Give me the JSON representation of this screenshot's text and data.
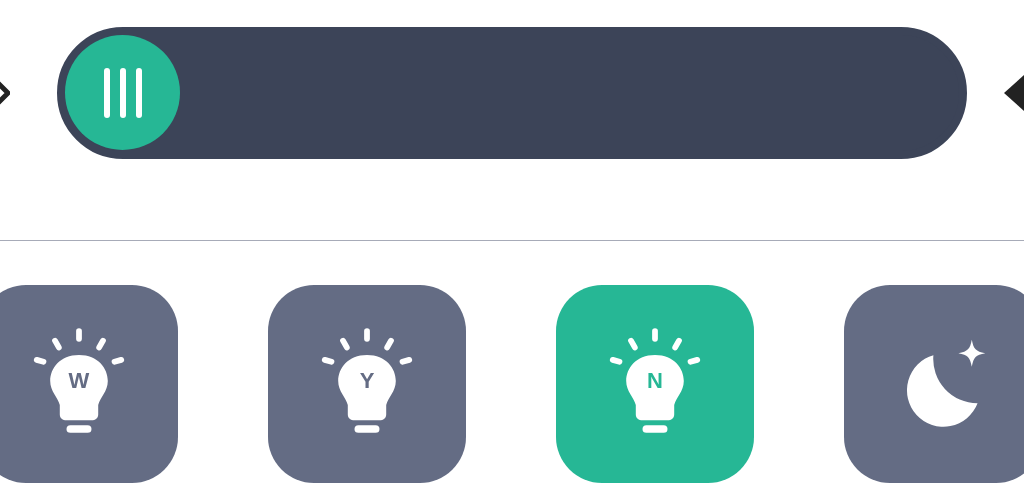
{
  "modes": [
    {
      "kind": "bulb",
      "label": "W",
      "selected": false
    },
    {
      "kind": "bulb",
      "label": "Y",
      "selected": false
    },
    {
      "kind": "bulb",
      "label": "N",
      "selected": true
    },
    {
      "kind": "moon",
      "selected": false
    }
  ]
}
